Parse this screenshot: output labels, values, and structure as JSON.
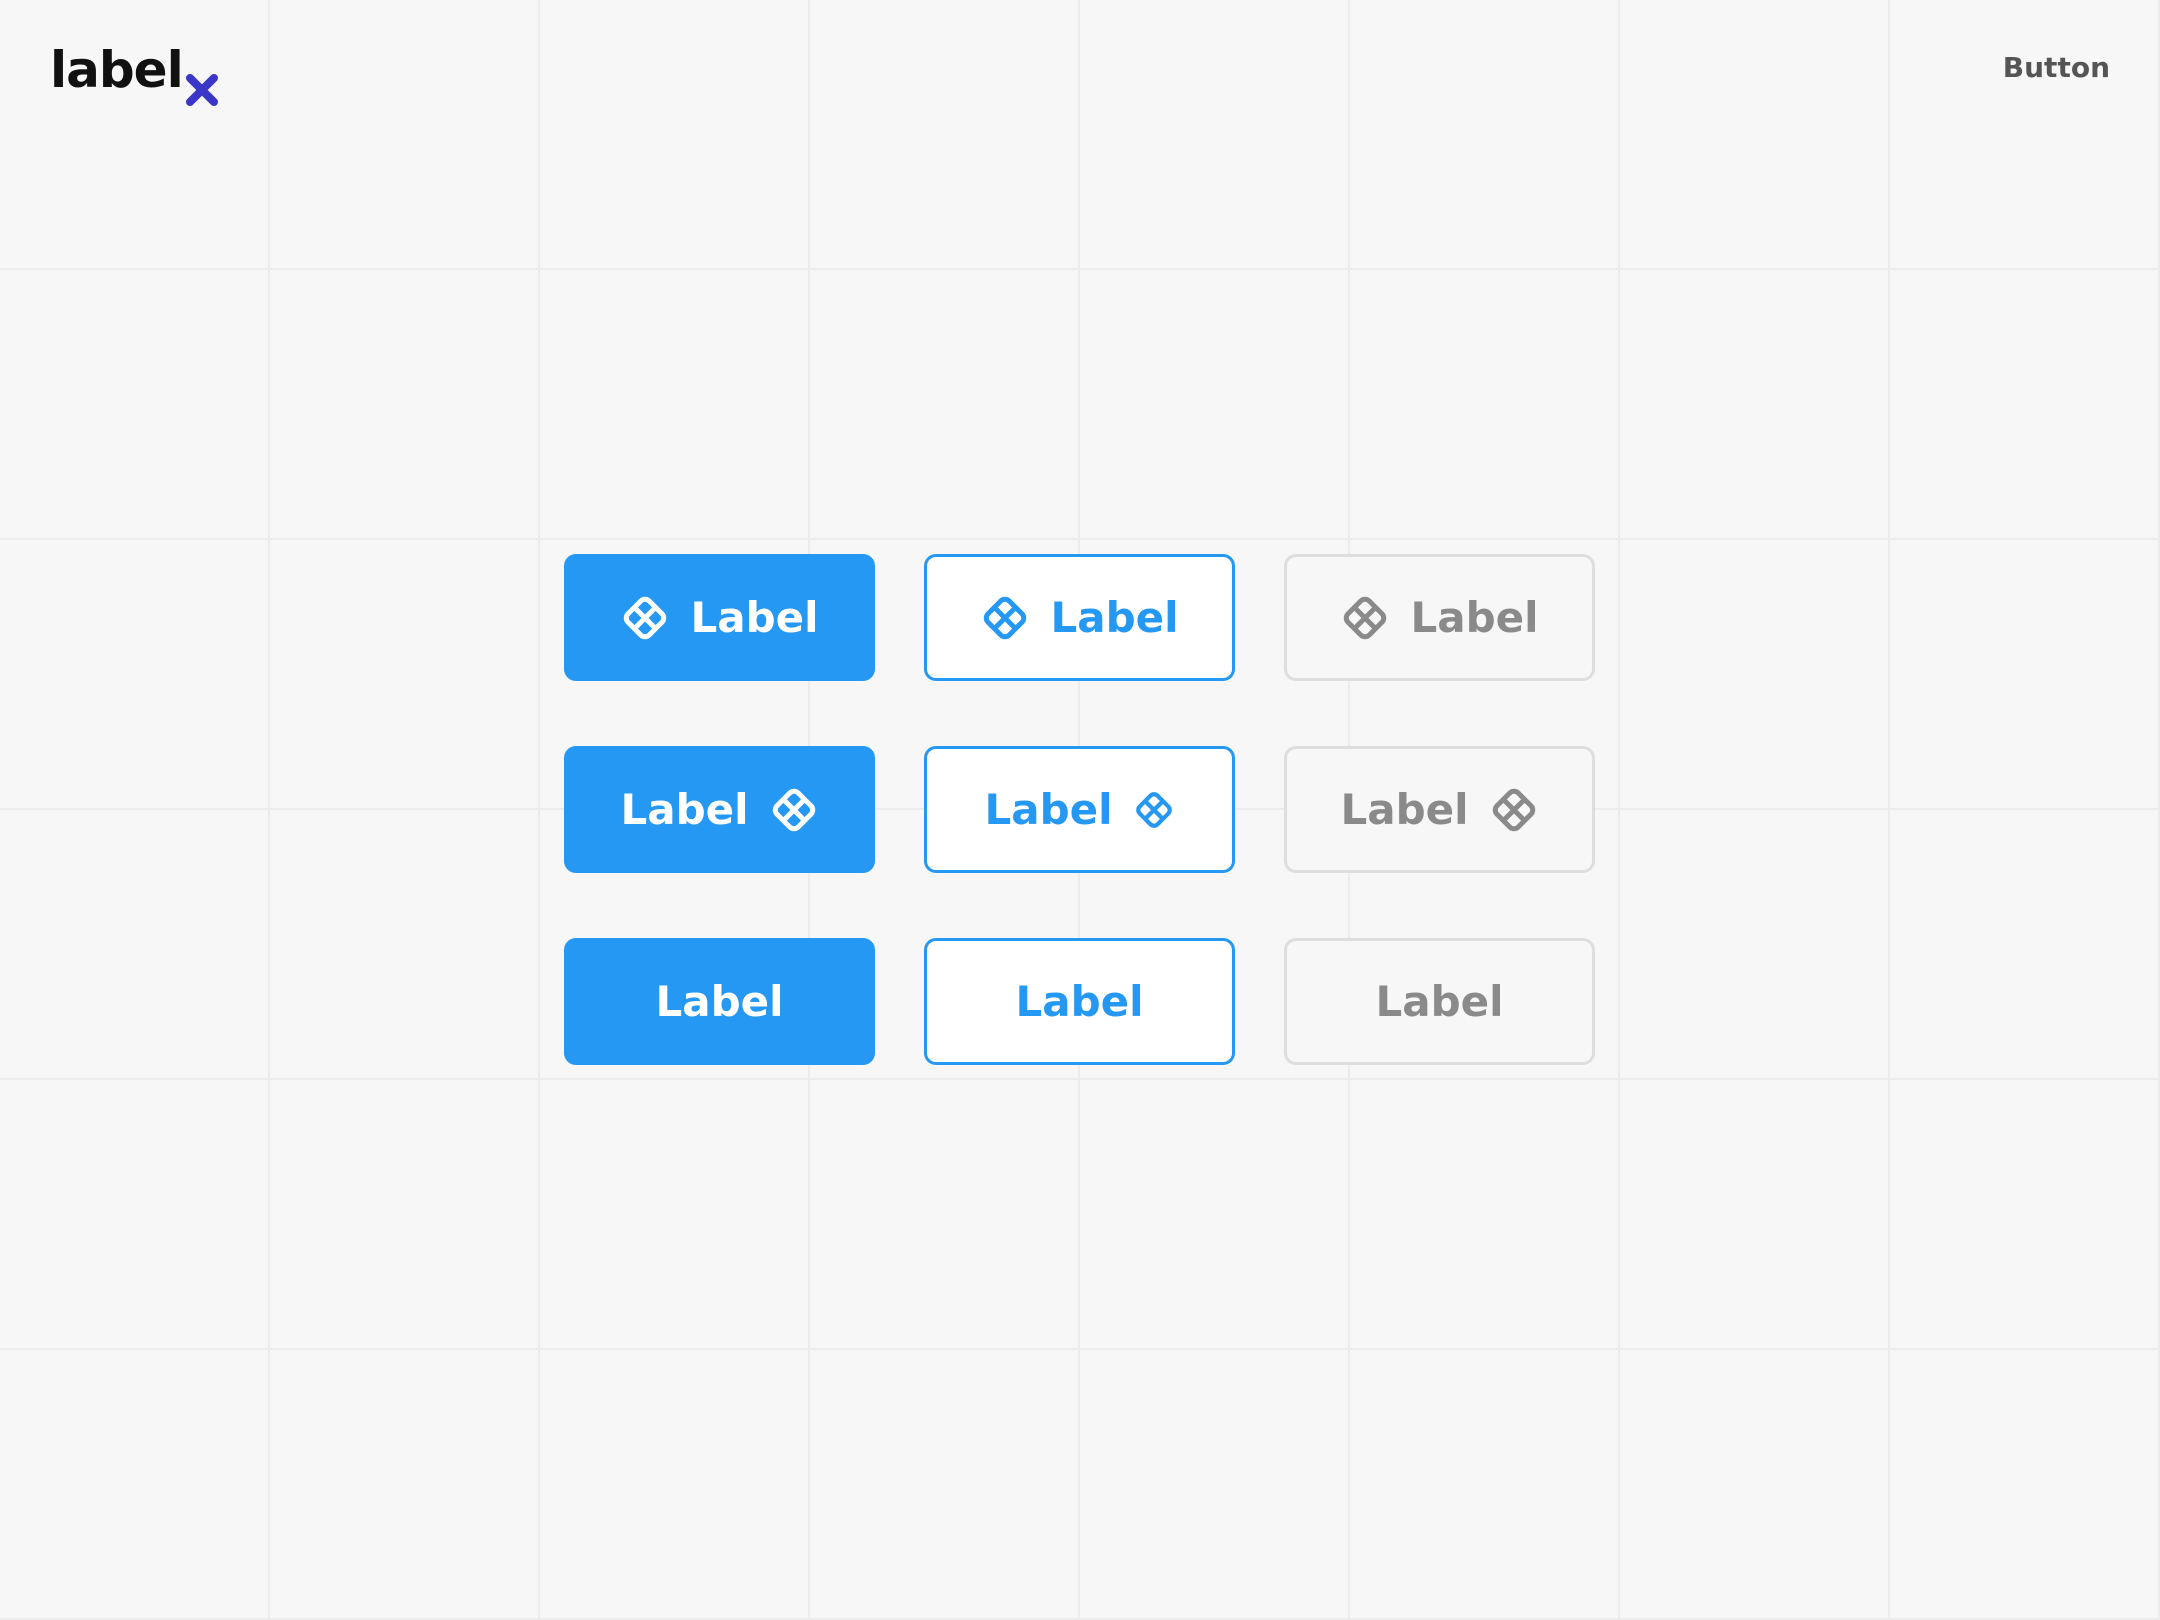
{
  "brand": {
    "name": "label",
    "mark": "x",
    "mark_color": "#3a37c8",
    "logo_icon": "x-mark-icon"
  },
  "page": {
    "title": "Button"
  },
  "colors": {
    "primary": "#2598f3",
    "ghost_text": "#8a8a8a",
    "ghost_border": "#dedede",
    "background": "#f7f7f7"
  },
  "buttons": {
    "row1": [
      {
        "label": "Label",
        "variant": "filled",
        "icon": "component-icon",
        "icon_position": "left"
      },
      {
        "label": "Label",
        "variant": "outline",
        "icon": "component-icon",
        "icon_position": "left"
      },
      {
        "label": "Label",
        "variant": "ghost",
        "icon": "component-icon",
        "icon_position": "left"
      }
    ],
    "row2": [
      {
        "label": "Label",
        "variant": "filled",
        "icon": "component-icon",
        "icon_position": "right"
      },
      {
        "label": "Label",
        "variant": "outline",
        "icon": "component-icon",
        "icon_position": "right"
      },
      {
        "label": "Label",
        "variant": "ghost",
        "icon": "component-icon",
        "icon_position": "right"
      }
    ],
    "row3": [
      {
        "label": "Label",
        "variant": "filled",
        "icon": null,
        "icon_position": "none"
      },
      {
        "label": "Label",
        "variant": "outline",
        "icon": null,
        "icon_position": "none"
      },
      {
        "label": "Label",
        "variant": "ghost",
        "icon": null,
        "icon_position": "none"
      }
    ]
  }
}
